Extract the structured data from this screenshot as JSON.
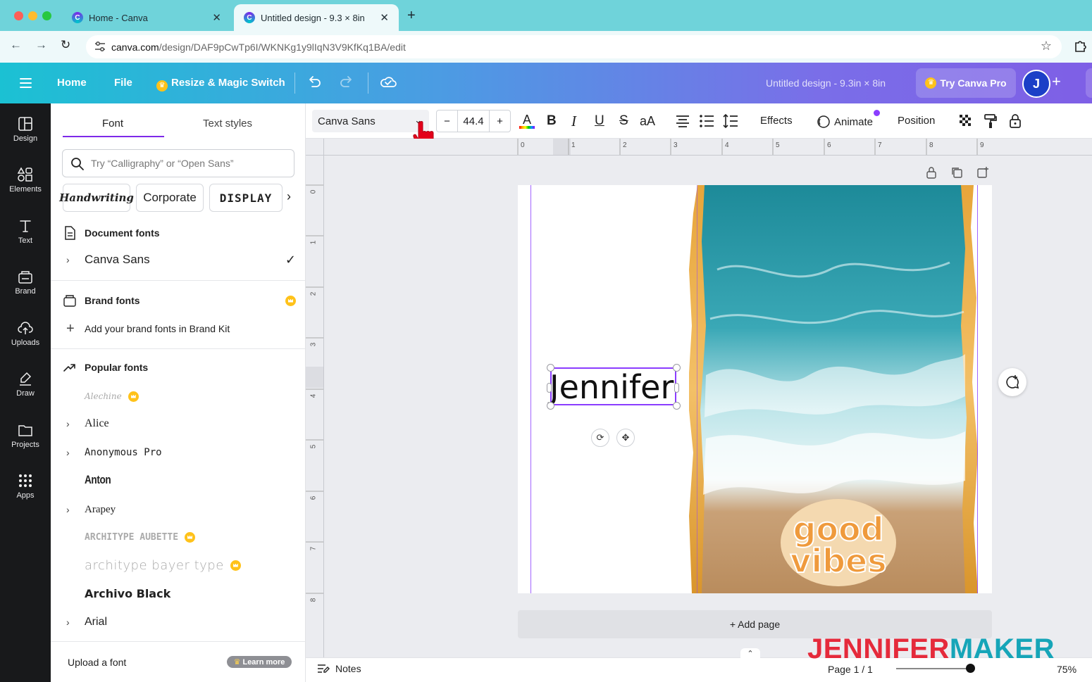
{
  "browser": {
    "tabs": [
      {
        "title": "Home - Canva",
        "active": false
      },
      {
        "title": "Untitled design - 9.3 × 8in",
        "active": true
      }
    ],
    "url_host": "canva.com",
    "url_path": "/design/DAF9pCwTp6I/WKNKg1y9lIqN3V9KfKq1BA/edit"
  },
  "header": {
    "home": "Home",
    "file": "File",
    "resize": "Resize & Magic Switch",
    "doc_title": "Untitled design - 9.3in × 8in",
    "try_pro": "Try Canva Pro",
    "avatar_initial": "J"
  },
  "rail": [
    {
      "label": "Design",
      "icon": "design-icon"
    },
    {
      "label": "Elements",
      "icon": "elements-icon"
    },
    {
      "label": "Text",
      "icon": "text-icon"
    },
    {
      "label": "Brand",
      "icon": "brand-icon"
    },
    {
      "label": "Uploads",
      "icon": "uploads-icon"
    },
    {
      "label": "Draw",
      "icon": "draw-icon"
    },
    {
      "label": "Projects",
      "icon": "projects-icon"
    },
    {
      "label": "Apps",
      "icon": "apps-icon"
    }
  ],
  "panel": {
    "tab_font": "Font",
    "tab_text_styles": "Text styles",
    "search_placeholder": "Try “Calligraphy” or “Open Sans”",
    "chips": [
      "Handwriting",
      "Corporate",
      "DISPLAY"
    ],
    "document_fonts": "Document fonts",
    "document_font_items": [
      {
        "name": "Canva Sans",
        "selected": true
      }
    ],
    "brand_fonts": "Brand fonts",
    "brand_add": "Add your brand fonts in Brand Kit",
    "popular_fonts": "Popular fonts",
    "popular_font_items": [
      {
        "name": "Alechine",
        "expandable": false,
        "pro": true
      },
      {
        "name": "Alice",
        "expandable": true,
        "pro": false
      },
      {
        "name": "Anonymous Pro",
        "expandable": true,
        "pro": false
      },
      {
        "name": "Anton",
        "expandable": false,
        "pro": false
      },
      {
        "name": "Arapey",
        "expandable": true,
        "pro": false
      },
      {
        "name": "ARCHITYPE AUBETTE",
        "expandable": false,
        "pro": true
      },
      {
        "name": "architype bayer type",
        "expandable": false,
        "pro": true
      },
      {
        "name": "Archivo Black",
        "expandable": false,
        "pro": false
      },
      {
        "name": "Arial",
        "expandable": true,
        "pro": false
      }
    ],
    "upload_font": "Upload a font",
    "learn_more": "Learn more"
  },
  "toolbar": {
    "font_name": "Canva Sans",
    "font_size": "44.4",
    "bold": "B",
    "italic": "I",
    "underline": "U",
    "strike": "S",
    "case": "aA",
    "effects": "Effects",
    "animate": "Animate",
    "position": "Position"
  },
  "ruler": {
    "h_ticks": [
      "0",
      "1",
      "2",
      "3",
      "4",
      "5",
      "6",
      "7",
      "8",
      "9"
    ],
    "v_ticks": [
      "0",
      "1",
      "2",
      "3",
      "4",
      "5",
      "6",
      "7",
      "8"
    ]
  },
  "canvas": {
    "text_element": "Jennifer",
    "add_page": "+ Add page",
    "sticker_line1": "good",
    "sticker_line2": "vibes"
  },
  "footer": {
    "notes": "Notes",
    "page": "Page 1 / 1",
    "zoom": "75%",
    "zoom_level_percent": 75
  },
  "watermark": {
    "part1": "JENNIFER",
    "part2": "MAKER"
  },
  "colors": {
    "accent_purple": "#7d2ae8",
    "selection": "#8b3dff",
    "crown_gold": "#ffc21a",
    "tabbar": "#6fd3da",
    "rail": "#18191b"
  }
}
